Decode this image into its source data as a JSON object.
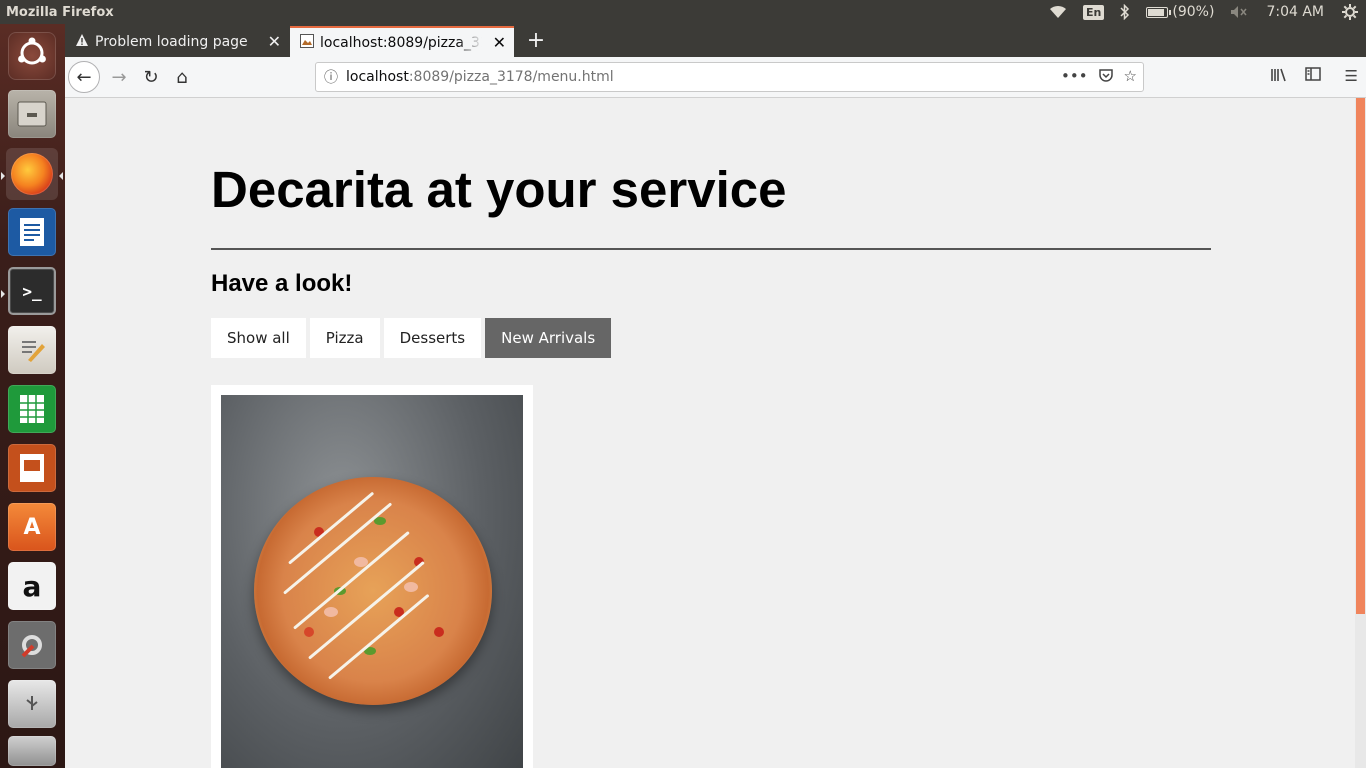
{
  "system": {
    "app_title": "Mozilla Firefox",
    "keyboard_layout": "En",
    "battery": "(90%)",
    "battery_fraction": 0.9,
    "clock": "7:04 AM"
  },
  "browser": {
    "tabs": [
      {
        "label": "Problem loading page",
        "icon": "warning-icon",
        "active": false
      },
      {
        "label": "localhost:8089/pizza_3178/menu.html",
        "icon": "page-icon",
        "active": true
      }
    ],
    "url_host": "localhost",
    "url_rest": ":8089/pizza_3178/menu.html"
  },
  "page": {
    "title": "Decarita at your service",
    "subtitle": "Have a look!",
    "filters": [
      {
        "label": "Show all",
        "selected": false
      },
      {
        "label": "Pizza",
        "selected": false
      },
      {
        "label": "Desserts",
        "selected": false
      },
      {
        "label": "New Arrivals",
        "selected": true
      }
    ]
  },
  "colors": {
    "accent": "#e66a40",
    "scroll_thumb": "#f0845c",
    "selected_filter": "#666666"
  }
}
